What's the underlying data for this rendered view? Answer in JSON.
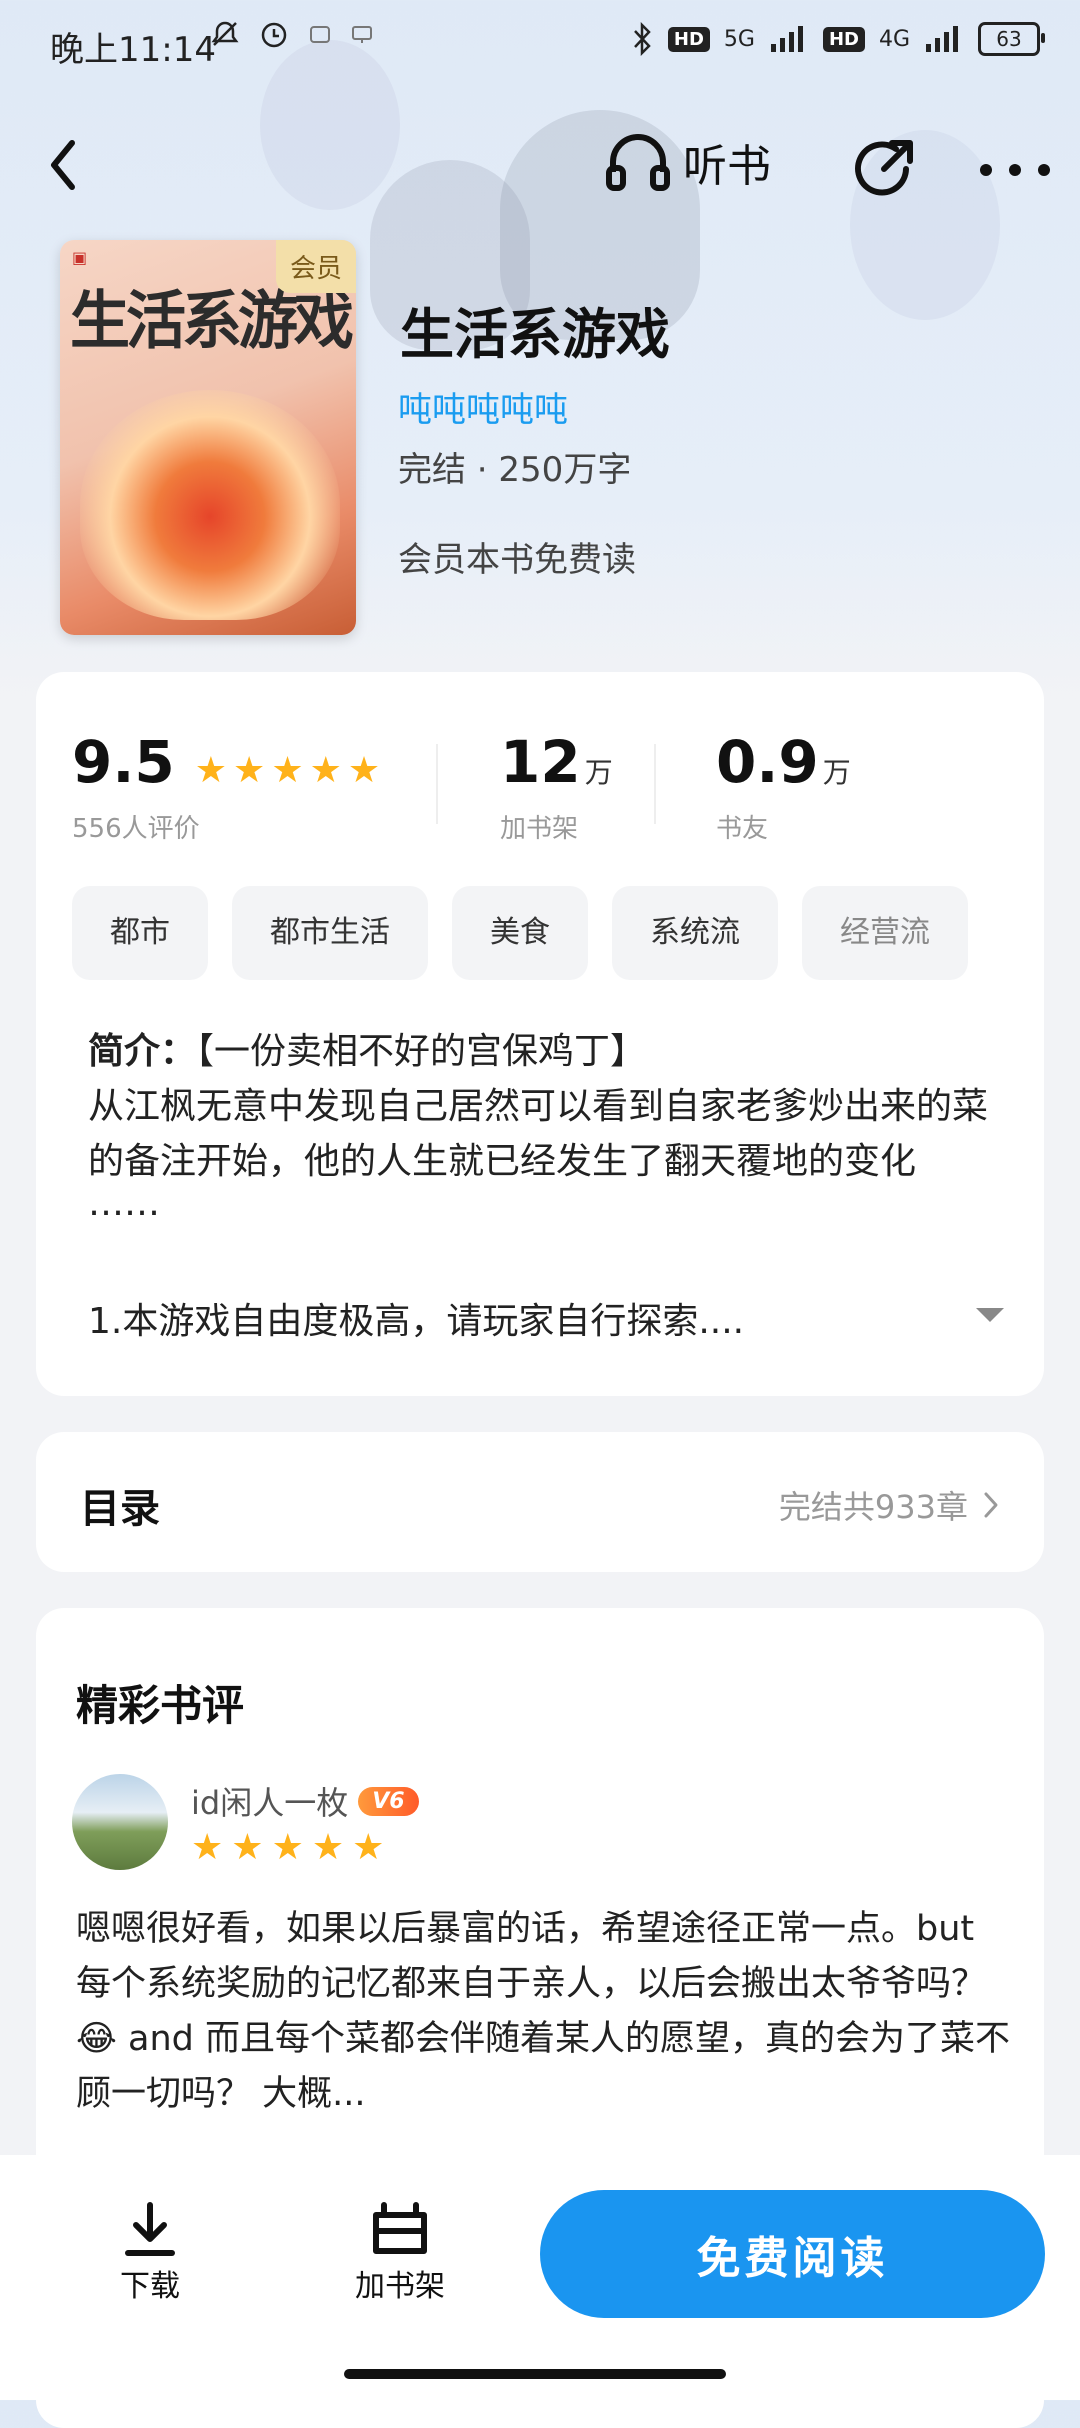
{
  "status_bar": {
    "time": "晚上11:14",
    "network_5g": "5G",
    "network_4g": "4G",
    "hd": "HD",
    "battery": "63"
  },
  "nav": {
    "listen_label": "听书"
  },
  "book": {
    "cover_title": "生活系游戏",
    "cover_badge": "会员",
    "title": "生活系游戏",
    "author": "吨吨吨吨吨",
    "status": "完结 · 250万字",
    "vip_note": "会员本书免费读"
  },
  "stats": {
    "rating": "9.5",
    "rating_count": "556人评价",
    "rating_stars": 5,
    "shelf_count": "12",
    "shelf_unit": "万",
    "shelf_label": "加书架",
    "fans_count": "0.9",
    "fans_unit": "万",
    "fans_label": "书友"
  },
  "tags": [
    "都市",
    "都市生活",
    "美食",
    "系统流",
    "经营流"
  ],
  "intro": {
    "label": "简介：",
    "headline": "【一份卖相不好的宫保鸡丁】",
    "body": "从江枫无意中发现自己居然可以看到自家老爹炒出来的菜的备注开始，他的人生就已经发生了翻天覆地的变化",
    "ellipsis": "……",
    "more": "1.本游戏自由度极高，请玩家自行探索...."
  },
  "toc": {
    "title": "目录",
    "info": "完结共933章"
  },
  "reviews": {
    "title": "精彩书评",
    "items": [
      {
        "user": "id闲人一枚",
        "level": "V6",
        "stars": 5,
        "text": "嗯嗯很好看，如果以后暴富的话，希望途径正常一点。but 每个系统奖励的记忆都来自于亲人，以后会搬出太爷爷吗？😂 and 而且每个菜都会伴随着某人的愿望，真的会为了菜不顾一切吗？ 大概..."
      }
    ]
  },
  "bottom": {
    "download_label": "下载",
    "shelf_label": "加书架",
    "read_label": "免费阅读"
  },
  "colors": {
    "accent": "#1a95f0",
    "author": "#1a9cf0",
    "star": "#ffb21a"
  }
}
